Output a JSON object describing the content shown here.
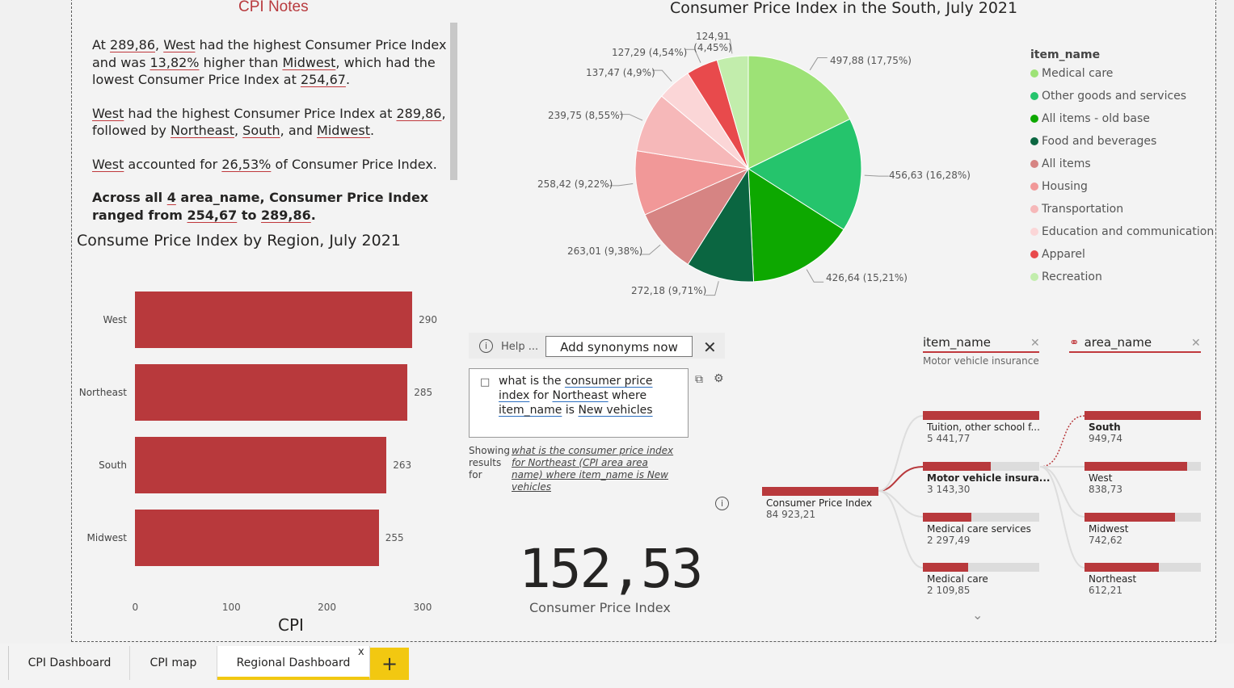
{
  "notes": {
    "title": "CPI Notes",
    "p1": [
      {
        "t": "At ",
        "u": false
      },
      {
        "t": "289,86",
        "u": true
      },
      {
        "t": ", ",
        "u": false
      },
      {
        "t": "West",
        "u": true
      },
      {
        "t": " had the highest Consumer Price Index and was ",
        "u": false
      },
      {
        "t": "13,82%",
        "u": true
      },
      {
        "t": " higher than ",
        "u": false
      },
      {
        "t": "Midwest",
        "u": true
      },
      {
        "t": ", which had the lowest Consumer Price Index at ",
        "u": false
      },
      {
        "t": "254,67",
        "u": true
      },
      {
        "t": ".",
        "u": false
      }
    ],
    "p2": [
      {
        "t": "West",
        "u": true
      },
      {
        "t": " had the highest Consumer Price Index at ",
        "u": false
      },
      {
        "t": "289,86",
        "u": true
      },
      {
        "t": ", followed by ",
        "u": false
      },
      {
        "t": "Northeast",
        "u": true
      },
      {
        "t": ", ",
        "u": false
      },
      {
        "t": "South",
        "u": true
      },
      {
        "t": ", and ",
        "u": false
      },
      {
        "t": "Midwest",
        "u": true
      },
      {
        "t": ".",
        "u": false
      }
    ],
    "p3": [
      {
        "t": "West",
        "u": true
      },
      {
        "t": " accounted for ",
        "u": false
      },
      {
        "t": "26,53%",
        "u": true
      },
      {
        "t": " of Consumer Price Index.",
        "u": false
      }
    ],
    "p4": [
      {
        "t": "Across all ",
        "u": false
      },
      {
        "t": "4",
        "u": true
      },
      {
        "t": " area_name, Consumer Price Index ranged from ",
        "u": false
      },
      {
        "t": "254,67",
        "u": true
      },
      {
        "t": " to ",
        "u": false
      },
      {
        "t": "289,86",
        "u": true
      },
      {
        "t": ".",
        "u": false
      }
    ]
  },
  "bar_chart": {
    "title": "Consume Price Index by Region, July 2021",
    "xlabel": "CPI",
    "color": "#b8393c",
    "chart_data": {
      "type": "bar",
      "orientation": "horizontal",
      "categories": [
        "West",
        "Northeast",
        "South",
        "Midwest"
      ],
      "values": [
        290,
        285,
        263,
        255
      ],
      "xticks": [
        "0",
        "100",
        "200",
        "300"
      ],
      "xlim": [
        0,
        300
      ],
      "xlabel": "CPI",
      "title": "Consume Price Index by Region, July 2021"
    }
  },
  "pie_chart": {
    "title": "Consumer Price Index in the South, July 2021",
    "legend_title": "item_name",
    "chart_data": {
      "type": "pie",
      "title": "Consumer Price Index in the South, July 2021",
      "legend_title": "item_name",
      "slices": [
        {
          "name": "Medical care",
          "value": 497.88,
          "label": "497,88 (17,75%)",
          "color": "#9de276"
        },
        {
          "name": "Other goods and services",
          "value": 456.63,
          "label": "456,63 (16,28%)",
          "color": "#25c46c"
        },
        {
          "name": "All items - old base",
          "value": 426.64,
          "label": "426,64 (15,21%)",
          "color": "#0da800"
        },
        {
          "name": "Food and beverages",
          "value": 272.18,
          "label": "272,18 (9,71%)",
          "color": "#0b6641"
        },
        {
          "name": "All items",
          "value": 263.01,
          "label": "263,01 (9,38%)",
          "color": "#d68483"
        },
        {
          "name": "Housing",
          "value": 258.42,
          "label": "258,42 (9,22%)",
          "color": "#f19898"
        },
        {
          "name": "Transportation",
          "value": 239.75,
          "label": "239,75 (8,55%)",
          "color": "#f6b8b9"
        },
        {
          "name": "Education and communication",
          "value": 137.47,
          "label": "137,47 (4,9%)",
          "color": "#fbd6d7"
        },
        {
          "name": "Apparel",
          "value": 127.29,
          "label": "127,29 (4,54%)",
          "color": "#e84a4c"
        },
        {
          "name": "Recreation",
          "value": 124.91,
          "label": "124,91 (4,45%)",
          "color": "#c2edac"
        }
      ]
    }
  },
  "qa": {
    "help": "Help ...",
    "synonyms_button": "Add synonyms now",
    "close": "✕",
    "question_parts": [
      {
        "t": "what is the ",
        "c": ""
      },
      {
        "t": "consumer price index",
        "c": "bu"
      },
      {
        "t": " for ",
        "c": ""
      },
      {
        "t": "Northeast",
        "c": "bu dotu"
      },
      {
        "t": " where ",
        "c": ""
      },
      {
        "t": "item_name",
        "c": "bu"
      },
      {
        "t": " is ",
        "c": ""
      },
      {
        "t": "New vehicles",
        "c": "bu"
      }
    ],
    "showing": "Showing results for",
    "result_link": "what is the consumer price index for Northeast (CPI area area name) where item_name is New vehicles",
    "card_value": "152,53",
    "card_label": "Consumer Price Index"
  },
  "decomp": {
    "header1": "item_name",
    "header1_sub": "Motor vehicle insurance",
    "header2": "area_name",
    "root": {
      "label": "Consumer Price Index",
      "value": "84 923,21"
    },
    "items": [
      {
        "label": "Tuition, other school f...",
        "value": "5 441,77",
        "fill": 1.0
      },
      {
        "label": "Motor vehicle insura...",
        "value": "3 143,30",
        "fill": 0.58
      },
      {
        "label": "Medical care services",
        "value": "2 297,49",
        "fill": 0.42
      },
      {
        "label": "Medical care",
        "value": "2 109,85",
        "fill": 0.39
      }
    ],
    "areas": [
      {
        "label": "South",
        "value": "949,74",
        "fill": 1.0
      },
      {
        "label": "West",
        "value": "838,73",
        "fill": 0.88
      },
      {
        "label": "Midwest",
        "value": "742,62",
        "fill": 0.78
      },
      {
        "label": "Northeast",
        "value": "612,21",
        "fill": 0.64
      }
    ]
  },
  "tabs": {
    "items": [
      "CPI Dashboard",
      "CPI map",
      "Regional Dashboard"
    ],
    "active": "Regional Dashboard",
    "close": "x",
    "add": "+"
  }
}
